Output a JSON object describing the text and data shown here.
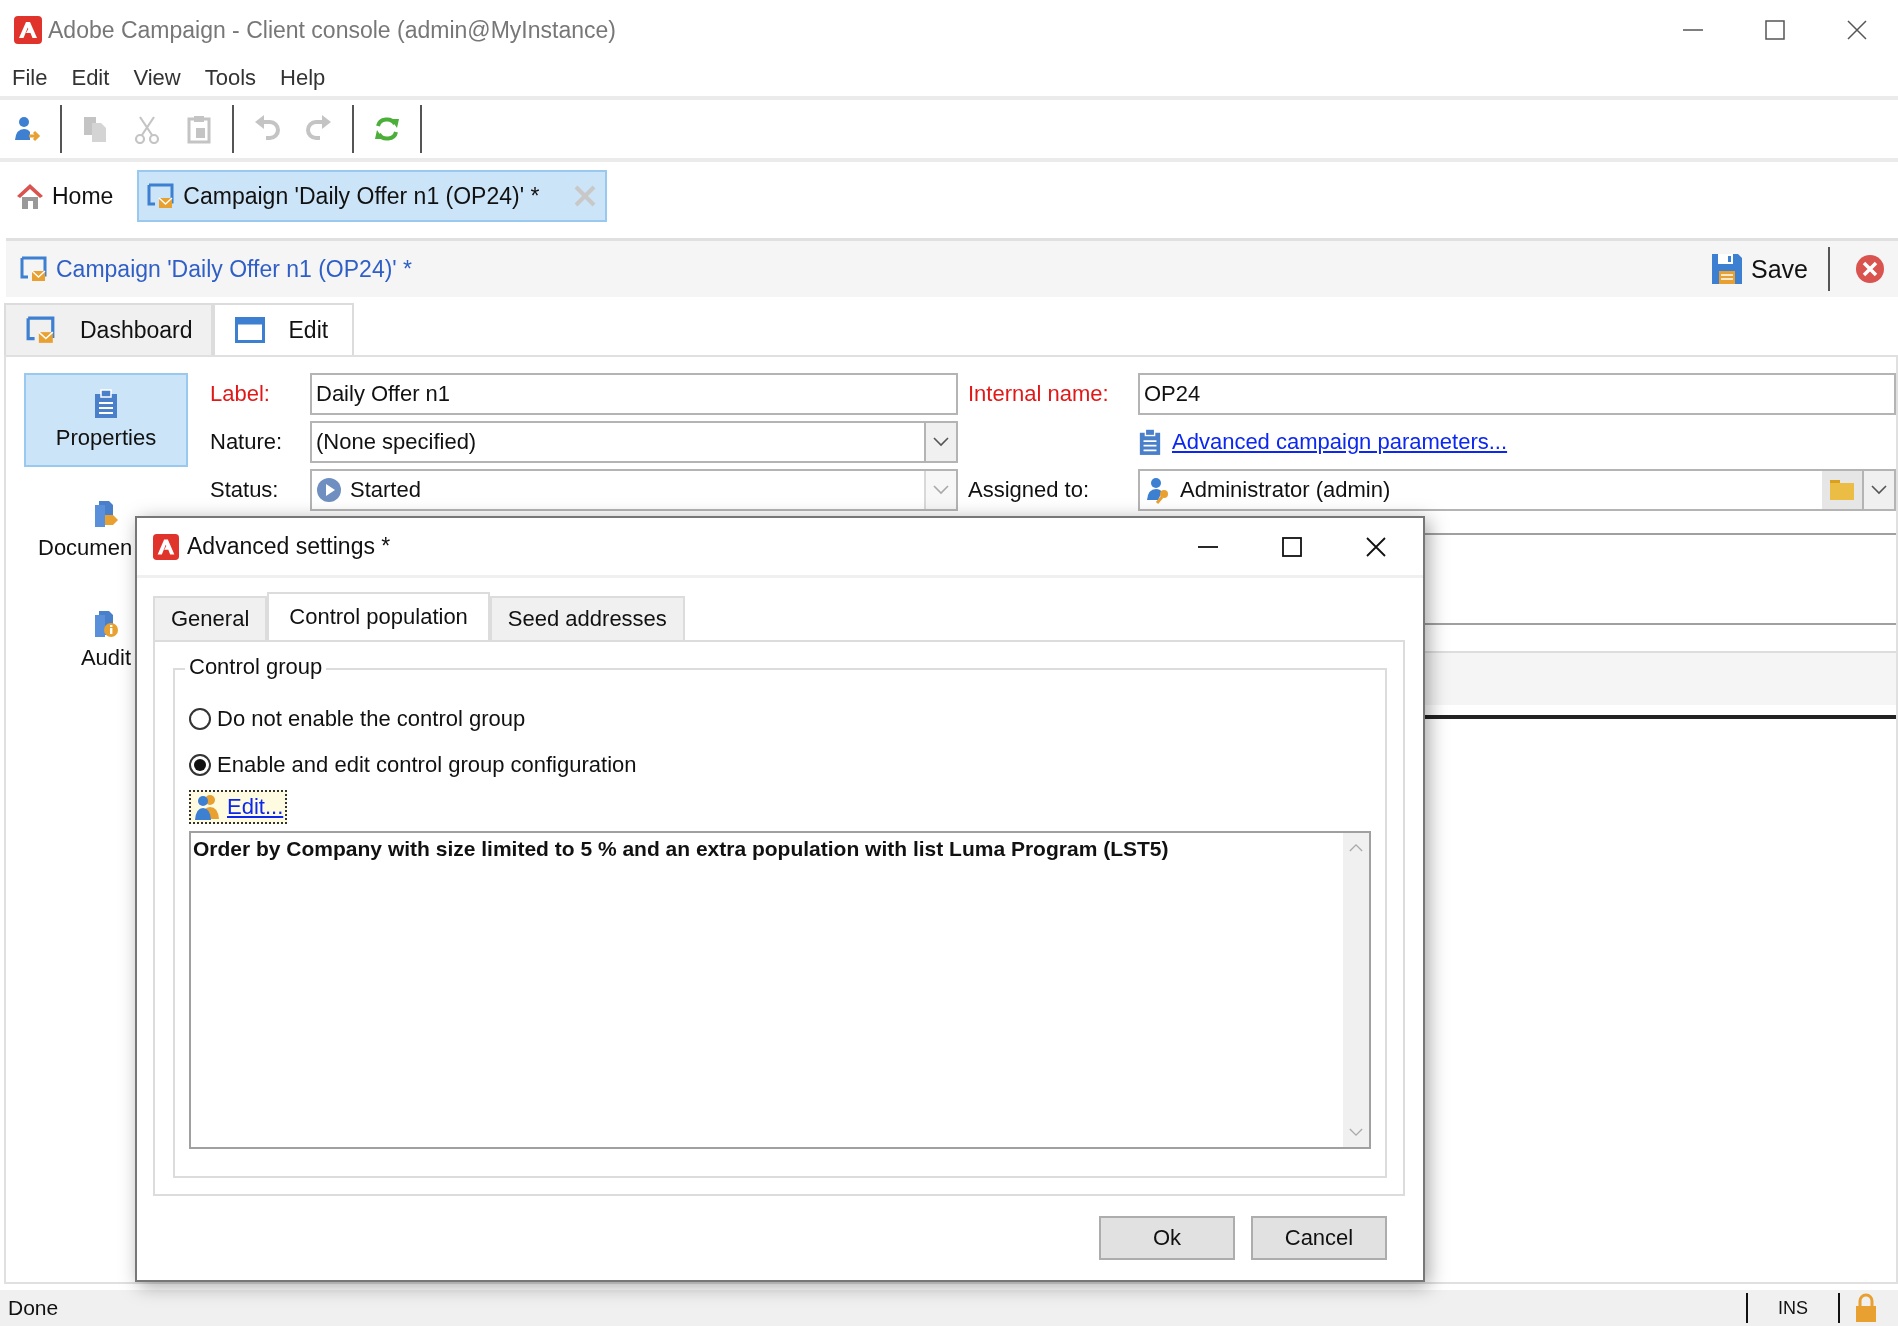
{
  "window": {
    "title": "Adobe Campaign - Client console (admin@MyInstance)"
  },
  "menu": [
    "File",
    "Edit",
    "View",
    "Tools",
    "Help"
  ],
  "toolbar": [
    {
      "tools": [
        {
          "kind": "logon",
          "disabled": false
        }
      ]
    },
    {
      "tools": [
        {
          "kind": "copy",
          "disabled": true
        },
        {
          "kind": "cut",
          "disabled": true
        },
        {
          "kind": "paste",
          "disabled": true
        }
      ]
    },
    {
      "tools": [
        {
          "kind": "undo",
          "disabled": true
        },
        {
          "kind": "redo",
          "disabled": true
        }
      ]
    },
    {
      "tools": [
        {
          "kind": "refresh",
          "disabled": false
        }
      ]
    }
  ],
  "tabs": [
    {
      "label": "Home",
      "kind": "home",
      "selected": false,
      "closable": false
    },
    {
      "label": "Campaign 'Daily Offer n1 (OP24)' *",
      "kind": "campaign",
      "selected": true,
      "closable": true
    }
  ],
  "header": {
    "title": "Campaign 'Daily Offer n1 (OP24)' *",
    "save": "Save"
  },
  "view_tabs": [
    {
      "label": "Dashboard",
      "kind": "dashboard",
      "selected": false
    },
    {
      "label": "Edit",
      "kind": "edit",
      "selected": true
    }
  ],
  "sidebar": [
    {
      "label": "Properties",
      "kind": "properties",
      "selected": true
    },
    {
      "label": "Documen",
      "kind": "documents",
      "selected": false
    },
    {
      "label": "Audit",
      "kind": "audit",
      "selected": false
    }
  ],
  "form": {
    "label": {
      "label": "Label:",
      "value": "Daily Offer n1",
      "required": true
    },
    "internal_name": {
      "label": "Internal name:",
      "value": "OP24",
      "required": true
    },
    "nature": {
      "label": "Nature:",
      "value": "(None specified)",
      "disabled": false
    },
    "status": {
      "label": "Status:",
      "value": "Started",
      "disabled": true
    },
    "advanced_link": "Advanced campaign parameters...",
    "assigned_to": {
      "label": "Assigned to:",
      "value": "Administrator (admin)"
    }
  },
  "dialog": {
    "title": "Advanced settings *",
    "tabs": [
      {
        "label": "General",
        "selected": false
      },
      {
        "label": "Control population",
        "selected": true
      },
      {
        "label": "Seed addresses",
        "selected": false
      }
    ],
    "group_title": "Control group",
    "options": [
      {
        "label": "Do not enable the control group",
        "selected": false
      },
      {
        "label": "Enable and edit control group configuration",
        "selected": true
      }
    ],
    "edit_link": {
      "label": "Edit...",
      "focused": true
    },
    "summary": "Order by Company with size limited to 5 % and an extra population with list Luma Program (LST5)",
    "buttons": [
      "Ok",
      "Cancel"
    ]
  },
  "status_bar": {
    "text": "Done",
    "mode": "INS"
  }
}
